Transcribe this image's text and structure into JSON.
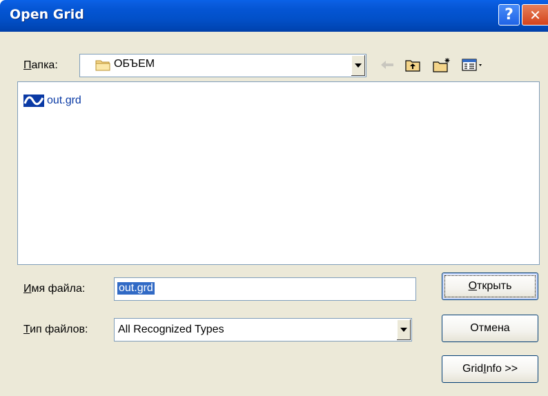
{
  "dialog": {
    "title": "Open Grid"
  },
  "titlebar": {
    "help_label": "?",
    "close_label": "✕"
  },
  "lookin": {
    "label_accel": "П",
    "label_rest": "апка:",
    "folder": "ОБЪЕМ"
  },
  "toolbar": {
    "icons": [
      "back-arrow-icon",
      "up-folder-icon",
      "new-folder-icon",
      "view-menu-icon"
    ]
  },
  "files": [
    {
      "name": "out.grd",
      "icon": "surfer-grid-icon"
    }
  ],
  "filename": {
    "label_accel": "И",
    "label_rest": "мя файла:",
    "value": "out.grd"
  },
  "filetype": {
    "label_accel": "Т",
    "label_rest": "ип файлов:",
    "value": "All Recognized Types"
  },
  "buttons": {
    "open_accel": "О",
    "open_rest": "ткрыть",
    "cancel": "Отмена",
    "info_pre": "Grid ",
    "info_accel": "I",
    "info_post": "nfo >>"
  },
  "colors": {
    "titlebar": "#0455d4",
    "dialog_bg": "#ece9d8",
    "selection": "#316ac5",
    "file_text": "#0a3aa5"
  }
}
